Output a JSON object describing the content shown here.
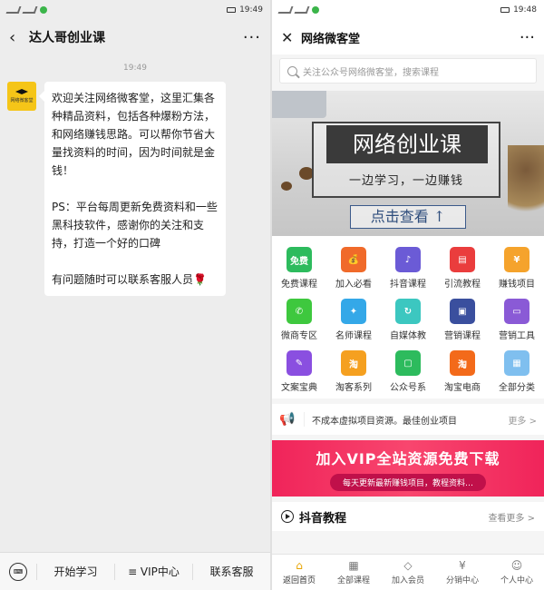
{
  "left": {
    "status": {
      "time": "19:49"
    },
    "nav": {
      "title": "达人哥创业课"
    },
    "chat": {
      "time": "19:49",
      "avatar_text": "网络微客堂",
      "paragraphs": [
        "欢迎关注网络微客堂，这里汇集各种精品资料，包括各种爆粉方法，和网络赚钱思路。可以帮你节省大量找资料的时间，因为时间就是金钱！",
        "PS：平台每周更新免费资料和一些黑科技软件，感谢你的关注和支持，打造一个好的口碑",
        "有问题随时可以联系客服人员🌹"
      ]
    },
    "menu": {
      "items": [
        "开始学习",
        "≡ VIP中心",
        "联系客服"
      ]
    }
  },
  "right": {
    "status": {
      "time": "19:48"
    },
    "nav": {
      "title": "网络微客堂"
    },
    "search": {
      "placeholder": "关注公众号网络微客堂，搜索课程"
    },
    "banner": {
      "headline": "网络创业课",
      "subline": "一边学习，一边赚钱",
      "cta": "点击查看 ↑"
    },
    "grid": [
      {
        "label": "免费课程",
        "icon": "免费",
        "color": "#2dbb5d"
      },
      {
        "label": "加入必看",
        "icon": "💰",
        "color": "#f06a2a"
      },
      {
        "label": "抖音课程",
        "icon": "♪",
        "color": "#6b5bd6"
      },
      {
        "label": "引流教程",
        "icon": "▤",
        "color": "#ea3d3d"
      },
      {
        "label": "赚钱项目",
        "icon": "¥",
        "color": "#f5a32c"
      },
      {
        "label": "微商专区",
        "icon": "✆",
        "color": "#3ec83e"
      },
      {
        "label": "名师课程",
        "icon": "✦",
        "color": "#34a8e8"
      },
      {
        "label": "自媒体教",
        "icon": "↻",
        "color": "#3cc7c0"
      },
      {
        "label": "营销课程",
        "icon": "▣",
        "color": "#3a4f9e"
      },
      {
        "label": "营销工具",
        "icon": "▭",
        "color": "#8a5ad6"
      },
      {
        "label": "文案宝典",
        "icon": "✎",
        "color": "#8a4fe0"
      },
      {
        "label": "淘客系列",
        "icon": "淘",
        "color": "#f5a020"
      },
      {
        "label": "公众号系",
        "icon": "▢",
        "color": "#2dbb5d"
      },
      {
        "label": "淘宝电商",
        "icon": "淘",
        "color": "#f36a1a"
      },
      {
        "label": "全部分类",
        "icon": "▦",
        "color": "#7fbfef"
      }
    ],
    "notice": {
      "text": "不成本虚拟项目资源。最佳创业项目",
      "more": "更多 >"
    },
    "vip": {
      "title": "加入VIP全站资源免费下载",
      "subtitle": "每天更新最新赚钱项目，教程资料…"
    },
    "section": {
      "title": "抖音教程",
      "more": "查看更多 >"
    },
    "tabs": [
      {
        "label": "返回首页",
        "icon": "⌂"
      },
      {
        "label": "全部课程",
        "icon": "▦"
      },
      {
        "label": "加入会员",
        "icon": "◇"
      },
      {
        "label": "分销中心",
        "icon": "¥"
      },
      {
        "label": "个人中心",
        "icon": "☺"
      }
    ]
  }
}
